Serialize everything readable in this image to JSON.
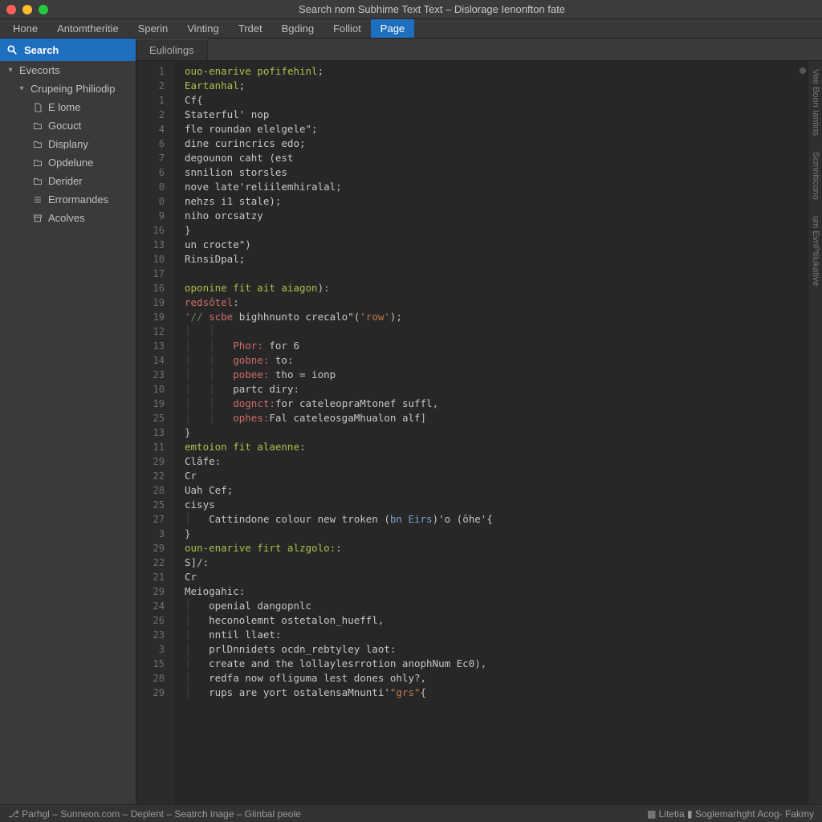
{
  "window": {
    "title": "Search nom Subhime Text Text – Dislorage Ienonfton fate"
  },
  "menu": {
    "items": [
      "Hone",
      "Antomtheritie",
      "Sperin",
      "Vinting",
      "Trdet",
      "Bgding",
      "Folliot",
      "Page"
    ],
    "active_index": 7
  },
  "sidebar": {
    "search_label": "Search",
    "groups": [
      {
        "label": "Evecorts",
        "expanded": true
      },
      {
        "label": "Crupeing Philiodip",
        "expanded": true
      }
    ],
    "items": [
      {
        "icon": "file-icon",
        "label": "E lome"
      },
      {
        "icon": "folder-icon",
        "label": "Gocuct"
      },
      {
        "icon": "folder-icon",
        "label": "Displany"
      },
      {
        "icon": "folder-icon",
        "label": "Opdelune"
      },
      {
        "icon": "folder-icon",
        "label": "Derider"
      },
      {
        "icon": "list-icon",
        "label": "Errormandes"
      },
      {
        "icon": "archive-icon",
        "label": "Acolves"
      }
    ]
  },
  "tabs": {
    "items": [
      {
        "label": "Euliolings"
      }
    ],
    "active_index": 0
  },
  "editor": {
    "gutter_numbers": [
      "1",
      "2",
      "1",
      "2",
      "4",
      "6",
      "7",
      "6",
      "0",
      "0",
      "9",
      "16",
      "13",
      "10",
      "17",
      "16",
      "19",
      "19",
      "12",
      "13",
      "14",
      "23",
      "10",
      "19",
      "25",
      "13",
      "11",
      "29",
      "22",
      "28",
      "25",
      "27",
      "3",
      "29",
      "22",
      "21",
      "29",
      "24",
      "26",
      "23",
      "3",
      "15",
      "28",
      "29"
    ],
    "lines": [
      {
        "indent": 0,
        "segments": [
          {
            "t": "ouo-enarive ",
            "c": "c-kw"
          },
          {
            "t": "pofifehinl",
            "c": "c-fn"
          },
          {
            "t": ";",
            "c": "c-pun"
          }
        ]
      },
      {
        "indent": 0,
        "segments": [
          {
            "t": "Eartanhal",
            "c": "c-kw"
          },
          {
            "t": ";",
            "c": "c-pun"
          }
        ]
      },
      {
        "indent": 0,
        "segments": [
          {
            "t": "Cf",
            "c": "c-def"
          },
          {
            "t": "{",
            "c": "c-pun"
          }
        ]
      },
      {
        "indent": 0,
        "segments": [
          {
            "t": "Staterful' nop",
            "c": "c-def"
          }
        ]
      },
      {
        "indent": 0,
        "segments": [
          {
            "t": "fle roundan elelgele",
            "c": "c-def"
          },
          {
            "t": "\";",
            "c": "c-pun"
          }
        ]
      },
      {
        "indent": 0,
        "segments": [
          {
            "t": "dine curincrics edo",
            "c": "c-def"
          },
          {
            "t": ";",
            "c": "c-pun"
          }
        ]
      },
      {
        "indent": 0,
        "segments": [
          {
            "t": "degounon caht (est",
            "c": "c-def"
          }
        ]
      },
      {
        "indent": 0,
        "segments": [
          {
            "t": "snnilion storsles",
            "c": "c-def"
          }
        ]
      },
      {
        "indent": 0,
        "segments": [
          {
            "t": "nove late'reliilemhiralal",
            "c": "c-def"
          },
          {
            "t": ";",
            "c": "c-pun"
          }
        ]
      },
      {
        "indent": 0,
        "segments": [
          {
            "t": "nehzs i1 stale)",
            "c": "c-def"
          },
          {
            "t": ";",
            "c": "c-pun"
          }
        ]
      },
      {
        "indent": 0,
        "segments": [
          {
            "t": "niho orcsatzy",
            "c": "c-def"
          }
        ]
      },
      {
        "indent": 0,
        "segments": [
          {
            "t": "}",
            "c": "c-pun"
          }
        ]
      },
      {
        "indent": 0,
        "segments": [
          {
            "t": "un crocte\")",
            "c": "c-def"
          }
        ]
      },
      {
        "indent": 0,
        "segments": [
          {
            "t": "RinsiDpal",
            "c": "c-def"
          },
          {
            "t": ";",
            "c": "c-pun"
          }
        ]
      },
      {
        "indent": 0,
        "segments": [
          {
            "t": "",
            "c": "c-def"
          }
        ]
      },
      {
        "indent": 0,
        "segments": [
          {
            "t": "oponine fit ait aiagon",
            "c": "c-kw"
          },
          {
            "t": "):",
            "c": "c-pun"
          }
        ]
      },
      {
        "indent": 0,
        "segments": [
          {
            "t": "redsôtel",
            "c": "c-id"
          },
          {
            "t": ":",
            "c": "c-pun"
          }
        ]
      },
      {
        "indent": 0,
        "segments": [
          {
            "t": "'// ",
            "c": "c-cmt"
          },
          {
            "t": "scbe ",
            "c": "c-id"
          },
          {
            "t": "bighhnunto crecalo\"(",
            "c": "c-def"
          },
          {
            "t": "'row'",
            "c": "c-str"
          },
          {
            "t": ");",
            "c": "c-pun"
          }
        ]
      },
      {
        "indent": 2,
        "segments": [
          {
            "t": "",
            "c": ""
          }
        ]
      },
      {
        "indent": 2,
        "segments": [
          {
            "t": "Phor:",
            "c": "c-id"
          },
          {
            "t": " for 6",
            "c": "c-def"
          }
        ]
      },
      {
        "indent": 2,
        "segments": [
          {
            "t": "gobne:",
            "c": "c-id"
          },
          {
            "t": " to:",
            "c": "c-def"
          }
        ]
      },
      {
        "indent": 2,
        "segments": [
          {
            "t": "pobee:",
            "c": "c-id"
          },
          {
            "t": " tho = ionp",
            "c": "c-def"
          }
        ]
      },
      {
        "indent": 2,
        "segments": [
          {
            "t": "partc diry",
            "c": "c-def"
          },
          {
            "t": ":",
            "c": "c-pun"
          }
        ]
      },
      {
        "indent": 2,
        "segments": [
          {
            "t": "dognct:",
            "c": "c-id"
          },
          {
            "t": "for cateleopraMtonef suffl",
            "c": "c-def"
          },
          {
            "t": ",",
            "c": "c-pun"
          }
        ]
      },
      {
        "indent": 2,
        "segments": [
          {
            "t": "ophes:",
            "c": "c-id"
          },
          {
            "t": "Fal cateleosgaMhualon alf",
            "c": "c-def"
          },
          {
            "t": "]",
            "c": "c-pun"
          }
        ]
      },
      {
        "indent": 0,
        "segments": [
          {
            "t": "}",
            "c": "c-pun"
          }
        ]
      },
      {
        "indent": 0,
        "segments": [
          {
            "t": "emtoion fit alaenne",
            "c": "c-kw"
          },
          {
            "t": ":",
            "c": "c-pun"
          }
        ]
      },
      {
        "indent": 0,
        "segments": [
          {
            "t": "Clâfe",
            "c": "c-def"
          },
          {
            "t": ":",
            "c": "c-pun"
          }
        ]
      },
      {
        "indent": 0,
        "segments": [
          {
            "t": "Cr",
            "c": "c-def"
          }
        ]
      },
      {
        "indent": 0,
        "segments": [
          {
            "t": "Uah Cef",
            "c": "c-def"
          },
          {
            "t": ";",
            "c": "c-pun"
          }
        ]
      },
      {
        "indent": 0,
        "segments": [
          {
            "t": "cisys",
            "c": "c-def"
          }
        ]
      },
      {
        "indent": 1,
        "segments": [
          {
            "t": "Cattindone colour new troken (",
            "c": "c-def"
          },
          {
            "t": "bn Eirs",
            "c": "c-type"
          },
          {
            "t": ")'o (öhe'{",
            "c": "c-def"
          }
        ]
      },
      {
        "indent": 0,
        "segments": [
          {
            "t": "}",
            "c": "c-pun"
          }
        ]
      },
      {
        "indent": 0,
        "segments": [
          {
            "t": "oun-enarive firt alzgolo:",
            "c": "c-kw"
          },
          {
            "t": ":",
            "c": "c-pun"
          }
        ]
      },
      {
        "indent": 0,
        "segments": [
          {
            "t": "S]",
            "c": "c-def"
          },
          {
            "t": "/:",
            "c": "c-pun"
          }
        ]
      },
      {
        "indent": 0,
        "segments": [
          {
            "t": "Cr",
            "c": "c-def"
          }
        ]
      },
      {
        "indent": 0,
        "segments": [
          {
            "t": "Meiogahic",
            "c": "c-def"
          },
          {
            "t": ":",
            "c": "c-pun"
          }
        ]
      },
      {
        "indent": 1,
        "segments": [
          {
            "t": "openial dangopnlc",
            "c": "c-def"
          }
        ]
      },
      {
        "indent": 1,
        "segments": [
          {
            "t": "heconolemnt ostetalon_hueffl",
            "c": "c-def"
          },
          {
            "t": ",",
            "c": "c-pun"
          }
        ]
      },
      {
        "indent": 1,
        "segments": [
          {
            "t": "nntil llaet",
            "c": "c-def"
          },
          {
            "t": ":",
            "c": "c-pun"
          }
        ]
      },
      {
        "indent": 1,
        "segments": [
          {
            "t": "prlDnnidets ocdn_rebtyley laot",
            "c": "c-def"
          },
          {
            "t": ":",
            "c": "c-pun"
          }
        ]
      },
      {
        "indent": 1,
        "segments": [
          {
            "t": "create and the lollaylesrrotion anophNum Ec0",
            "c": "c-def"
          },
          {
            "t": "),",
            "c": "c-pun"
          }
        ]
      },
      {
        "indent": 1,
        "segments": [
          {
            "t": "redfa now ofliguma lest dones ohly",
            "c": "c-def"
          },
          {
            "t": "?,",
            "c": "c-pun"
          }
        ]
      },
      {
        "indent": 1,
        "segments": [
          {
            "t": "rups are yort ostalensaMnunti'",
            "c": "c-def"
          },
          {
            "t": "\"grs\"",
            "c": "c-str"
          },
          {
            "t": "{",
            "c": "c-pun"
          }
        ]
      }
    ]
  },
  "right_vertical_tabs": [
    "Vee Boon Iantins",
    "Scmniticono",
    "um EvnPtilukative"
  ],
  "status": {
    "left": [
      "Parhgl",
      "– Sunneon.com –",
      "Deplent –",
      "Seatrch inage –",
      "Giinbal peole"
    ],
    "right": [
      "Litetia",
      "Soglemarhght Acog-",
      "Fakmy"
    ]
  }
}
